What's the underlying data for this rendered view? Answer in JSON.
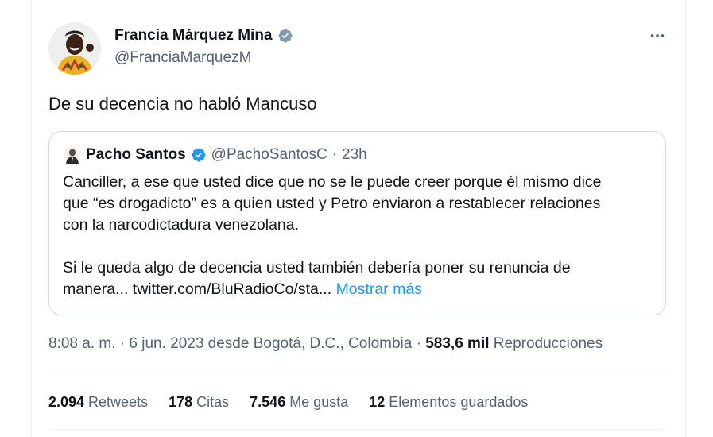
{
  "author": {
    "display_name": "Francia Márquez Mina",
    "handle": "@FranciaMarquezM"
  },
  "icons": {
    "more": "more-horizontal-icon",
    "verified": "verified-badge-icon"
  },
  "colors": {
    "text_primary": "#0f1419",
    "text_secondary": "#536471",
    "link": "#1d9bf0",
    "border": "#cfd9de",
    "verified": "#1d9bf0"
  },
  "tweet": {
    "text": "De su decencia no habló Mancuso"
  },
  "quoted": {
    "display_name": "Pacho Santos",
    "handle": "@PachoSantosC",
    "separator": "·",
    "time": "23h",
    "lines": [
      "Canciller, a ese que usted dice que no se le puede creer porque él mismo dice",
      "que “es drogadicto” es a quien usted y Petro enviaron a restablecer relaciones",
      "con la narcodictadura venezolana.",
      "Si le queda algo de decencia usted también debería poner su renuncia de"
    ],
    "last_line_text": "manera... twitter.com/BluRadioCo/sta...",
    "show_more": "Mostrar más"
  },
  "meta": {
    "timestamp": "8:08 a. m. · 6 jun. 2023 desde Bogotá, D.C., Colombia",
    "separator": "·",
    "views_count": "583,6 mil",
    "views_label": "Reproducciones"
  },
  "stats": [
    {
      "count": "2.094",
      "label": "Retweets"
    },
    {
      "count": "178",
      "label": "Citas"
    },
    {
      "count": "7.546",
      "label": "Me gusta"
    },
    {
      "count": "12",
      "label": "Elementos guardados"
    }
  ]
}
